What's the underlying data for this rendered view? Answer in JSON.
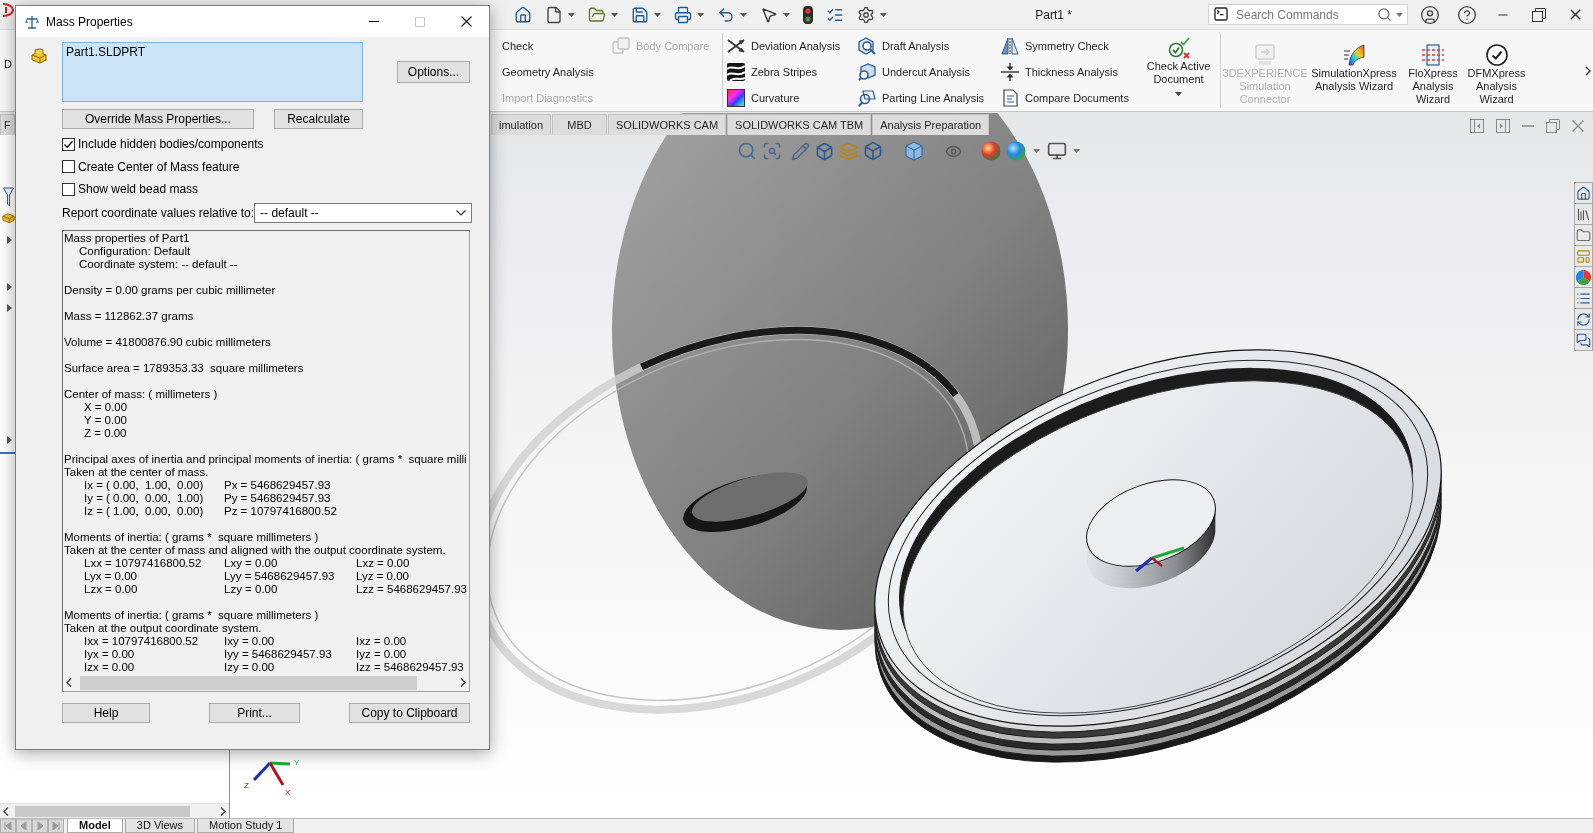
{
  "app": {
    "title": "Part1 *",
    "search": {
      "placeholder": "Search Commands"
    }
  },
  "ribbon": {
    "fragment": "D",
    "groups": [
      {
        "columns": [
          [
            {
              "label": "Check",
              "disabled": false
            },
            {
              "label": "Geometry Analysis",
              "disabled": false
            },
            {
              "label": "Import Diagnostics",
              "disabled": true
            }
          ],
          [
            {
              "label": "Body Compare",
              "disabled": true
            }
          ]
        ]
      },
      {
        "columns": [
          [
            {
              "label": "Deviation Analysis",
              "disabled": false
            },
            {
              "label": "Zebra Stripes",
              "disabled": false
            },
            {
              "label": "Curvature",
              "disabled": false
            }
          ],
          [
            {
              "label": "Draft Analysis",
              "disabled": false
            },
            {
              "label": "Undercut Analysis",
              "disabled": false
            },
            {
              "label": "Parting Line Analysis",
              "disabled": false
            }
          ],
          [
            {
              "label": "Symmetry Check",
              "disabled": false
            },
            {
              "label": "Thickness Analysis",
              "disabled": false
            },
            {
              "label": "Compare Documents",
              "disabled": false
            }
          ]
        ],
        "buttons": [
          {
            "lines": [
              "Check Active",
              "Document"
            ],
            "disabled": false,
            "dropdown": true
          }
        ]
      },
      {
        "buttons": [
          {
            "lines": [
              "3DEXPERIENCE",
              "Simulation",
              "Connector"
            ],
            "disabled": true,
            "dropdown": false
          },
          {
            "lines": [
              "SimulationXpress",
              "Analysis Wizard"
            ],
            "disabled": false,
            "dropdown": false
          },
          {
            "lines": [
              "FloXpress",
              "Analysis",
              "Wizard"
            ],
            "disabled": false,
            "dropdown": false
          },
          {
            "lines": [
              "DFMXpress",
              "Analysis",
              "Wizard"
            ],
            "disabled": false,
            "dropdown": false
          }
        ]
      }
    ]
  },
  "tabs": {
    "left": [
      {
        "label": "F",
        "selected": false
      }
    ],
    "right": [
      {
        "label": "imulation",
        "selected": false
      },
      {
        "label": "MBD",
        "selected": false
      },
      {
        "label": "SOLIDWORKS CAM",
        "selected": false
      },
      {
        "label": "SOLIDWORKS CAM TBM",
        "selected": false
      },
      {
        "label": "Analysis Preparation",
        "selected": false
      }
    ]
  },
  "triad": {
    "labels": [
      "Y",
      "Z",
      "X"
    ]
  },
  "bottom_tabs": [
    {
      "label": "Model",
      "selected": true
    },
    {
      "label": "3D Views",
      "selected": false
    },
    {
      "label": "Motion Study 1",
      "selected": false
    }
  ],
  "dialog": {
    "title": "Mass Properties",
    "selection": [
      "Part1.SLDPRT"
    ],
    "options_button": "Options...",
    "override_button": "Override Mass Properties...",
    "recalculate_button": "Recalculate",
    "checkboxes": [
      {
        "label": "Include hidden bodies/components",
        "checked": true
      },
      {
        "label": "Create Center of Mass feature",
        "checked": false
      },
      {
        "label": "Show weld bead mass",
        "checked": false
      }
    ],
    "coordinate": {
      "label": "Report coordinate values relative to:",
      "value": "-- default --"
    },
    "results": [
      [
        {
          "kind": "heading",
          "cells": [
            "Mass properties of Part1"
          ]
        },
        {
          "kind": "item",
          "cells": [
            "Configuration: Default"
          ]
        },
        {
          "kind": "item",
          "cells": [
            "Coordinate system: -- default --"
          ]
        }
      ],
      [
        {
          "kind": "heading",
          "cells": [
            "Density = 0.00 grams per cubic millimeter"
          ]
        }
      ],
      [
        {
          "kind": "heading",
          "cells": [
            "Mass = 112862.37 grams"
          ]
        }
      ],
      [
        {
          "kind": "heading",
          "cells": [
            "Volume = 41800876.90 cubic millimeters"
          ]
        }
      ],
      [
        {
          "kind": "heading",
          "cells": [
            "Surface area = 1789353.33  square millimeters"
          ]
        }
      ],
      [
        {
          "kind": "heading",
          "cells": [
            "Center of mass: ( millimeters )"
          ]
        },
        {
          "kind": "row",
          "cells": [
            "X = 0.00"
          ]
        },
        {
          "kind": "row",
          "cells": [
            "Y = 0.00"
          ]
        },
        {
          "kind": "row",
          "cells": [
            "Z = 0.00"
          ]
        }
      ],
      [
        {
          "kind": "heading",
          "cells": [
            "Principal axes of inertia and principal moments of inertia: ( grams *  square milli"
          ]
        },
        {
          "kind": "heading",
          "cells": [
            "Taken at the center of mass."
          ]
        },
        {
          "kind": "row",
          "cells": [
            "Ix = ( 0.00,  1.00,  0.00)",
            "Px = 5468629457.93"
          ]
        },
        {
          "kind": "row",
          "cells": [
            "Iy = ( 0.00,  0.00,  1.00)",
            "Py = 5468629457.93"
          ]
        },
        {
          "kind": "row",
          "cells": [
            "Iz = ( 1.00,  0.00,  0.00)",
            "Pz = 10797416800.52"
          ]
        }
      ],
      [
        {
          "kind": "heading",
          "cells": [
            "Moments of inertia: ( grams *  square millimeters )"
          ]
        },
        {
          "kind": "heading",
          "cells": [
            "Taken at the center of mass and aligned with the output coordinate system."
          ]
        },
        {
          "kind": "row",
          "cells": [
            "Lxx = 10797416800.52",
            "Lxy = 0.00",
            "Lxz = 0.00"
          ]
        },
        {
          "kind": "row",
          "cells": [
            "Lyx = 0.00",
            "Lyy = 5468629457.93",
            "Lyz = 0.00"
          ]
        },
        {
          "kind": "row",
          "cells": [
            "Lzx = 0.00",
            "Lzy = 0.00",
            "Lzz = 5468629457.93"
          ]
        }
      ],
      [
        {
          "kind": "heading",
          "cells": [
            "Moments of inertia: ( grams *  square millimeters )"
          ]
        },
        {
          "kind": "heading",
          "cells": [
            "Taken at the output coordinate system."
          ]
        },
        {
          "kind": "row",
          "cells": [
            "Ixx = 10797416800.52",
            "Ixy = 0.00",
            "Ixz = 0.00"
          ]
        },
        {
          "kind": "row",
          "cells": [
            "Iyx = 0.00",
            "Iyy = 5468629457.93",
            "Iyz = 0.00"
          ]
        },
        {
          "kind": "row",
          "cells": [
            "Izx = 0.00",
            "Izy = 0.00",
            "Izz = 5468629457.93"
          ]
        }
      ]
    ],
    "buttons": [
      "Help",
      "Print...",
      "Copy to Clipboard"
    ]
  }
}
